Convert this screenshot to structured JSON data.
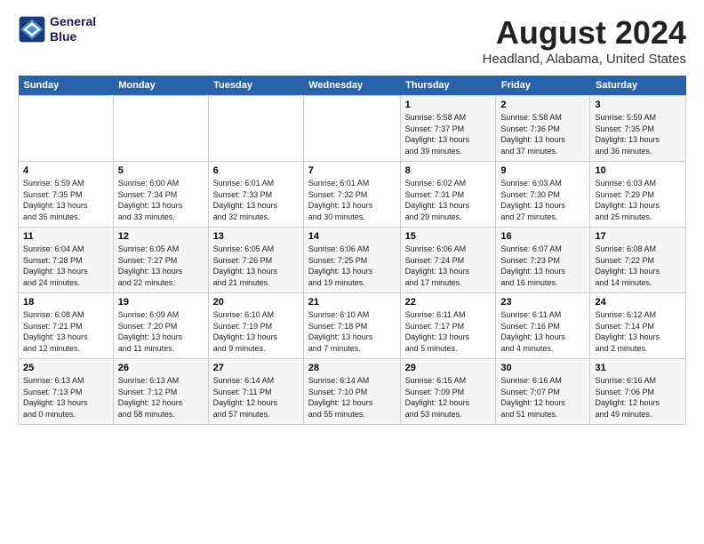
{
  "header": {
    "logo_line1": "General",
    "logo_line2": "Blue",
    "month": "August 2024",
    "location": "Headland, Alabama, United States"
  },
  "weekdays": [
    "Sunday",
    "Monday",
    "Tuesday",
    "Wednesday",
    "Thursday",
    "Friday",
    "Saturday"
  ],
  "weeks": [
    [
      {
        "day": "",
        "info": ""
      },
      {
        "day": "",
        "info": ""
      },
      {
        "day": "",
        "info": ""
      },
      {
        "day": "",
        "info": ""
      },
      {
        "day": "1",
        "info": "Sunrise: 5:58 AM\nSunset: 7:37 PM\nDaylight: 13 hours\nand 39 minutes."
      },
      {
        "day": "2",
        "info": "Sunrise: 5:58 AM\nSunset: 7:36 PM\nDaylight: 13 hours\nand 37 minutes."
      },
      {
        "day": "3",
        "info": "Sunrise: 5:59 AM\nSunset: 7:35 PM\nDaylight: 13 hours\nand 36 minutes."
      }
    ],
    [
      {
        "day": "4",
        "info": "Sunrise: 5:59 AM\nSunset: 7:35 PM\nDaylight: 13 hours\nand 35 minutes."
      },
      {
        "day": "5",
        "info": "Sunrise: 6:00 AM\nSunset: 7:34 PM\nDaylight: 13 hours\nand 33 minutes."
      },
      {
        "day": "6",
        "info": "Sunrise: 6:01 AM\nSunset: 7:33 PM\nDaylight: 13 hours\nand 32 minutes."
      },
      {
        "day": "7",
        "info": "Sunrise: 6:01 AM\nSunset: 7:32 PM\nDaylight: 13 hours\nand 30 minutes."
      },
      {
        "day": "8",
        "info": "Sunrise: 6:02 AM\nSunset: 7:31 PM\nDaylight: 13 hours\nand 29 minutes."
      },
      {
        "day": "9",
        "info": "Sunrise: 6:03 AM\nSunset: 7:30 PM\nDaylight: 13 hours\nand 27 minutes."
      },
      {
        "day": "10",
        "info": "Sunrise: 6:03 AM\nSunset: 7:29 PM\nDaylight: 13 hours\nand 25 minutes."
      }
    ],
    [
      {
        "day": "11",
        "info": "Sunrise: 6:04 AM\nSunset: 7:28 PM\nDaylight: 13 hours\nand 24 minutes."
      },
      {
        "day": "12",
        "info": "Sunrise: 6:05 AM\nSunset: 7:27 PM\nDaylight: 13 hours\nand 22 minutes."
      },
      {
        "day": "13",
        "info": "Sunrise: 6:05 AM\nSunset: 7:26 PM\nDaylight: 13 hours\nand 21 minutes."
      },
      {
        "day": "14",
        "info": "Sunrise: 6:06 AM\nSunset: 7:25 PM\nDaylight: 13 hours\nand 19 minutes."
      },
      {
        "day": "15",
        "info": "Sunrise: 6:06 AM\nSunset: 7:24 PM\nDaylight: 13 hours\nand 17 minutes."
      },
      {
        "day": "16",
        "info": "Sunrise: 6:07 AM\nSunset: 7:23 PM\nDaylight: 13 hours\nand 16 minutes."
      },
      {
        "day": "17",
        "info": "Sunrise: 6:08 AM\nSunset: 7:22 PM\nDaylight: 13 hours\nand 14 minutes."
      }
    ],
    [
      {
        "day": "18",
        "info": "Sunrise: 6:08 AM\nSunset: 7:21 PM\nDaylight: 13 hours\nand 12 minutes."
      },
      {
        "day": "19",
        "info": "Sunrise: 6:09 AM\nSunset: 7:20 PM\nDaylight: 13 hours\nand 11 minutes."
      },
      {
        "day": "20",
        "info": "Sunrise: 6:10 AM\nSunset: 7:19 PM\nDaylight: 13 hours\nand 9 minutes."
      },
      {
        "day": "21",
        "info": "Sunrise: 6:10 AM\nSunset: 7:18 PM\nDaylight: 13 hours\nand 7 minutes."
      },
      {
        "day": "22",
        "info": "Sunrise: 6:11 AM\nSunset: 7:17 PM\nDaylight: 13 hours\nand 5 minutes."
      },
      {
        "day": "23",
        "info": "Sunrise: 6:11 AM\nSunset: 7:16 PM\nDaylight: 13 hours\nand 4 minutes."
      },
      {
        "day": "24",
        "info": "Sunrise: 6:12 AM\nSunset: 7:14 PM\nDaylight: 13 hours\nand 2 minutes."
      }
    ],
    [
      {
        "day": "25",
        "info": "Sunrise: 6:13 AM\nSunset: 7:13 PM\nDaylight: 13 hours\nand 0 minutes."
      },
      {
        "day": "26",
        "info": "Sunrise: 6:13 AM\nSunset: 7:12 PM\nDaylight: 12 hours\nand 58 minutes."
      },
      {
        "day": "27",
        "info": "Sunrise: 6:14 AM\nSunset: 7:11 PM\nDaylight: 12 hours\nand 57 minutes."
      },
      {
        "day": "28",
        "info": "Sunrise: 6:14 AM\nSunset: 7:10 PM\nDaylight: 12 hours\nand 55 minutes."
      },
      {
        "day": "29",
        "info": "Sunrise: 6:15 AM\nSunset: 7:09 PM\nDaylight: 12 hours\nand 53 minutes."
      },
      {
        "day": "30",
        "info": "Sunrise: 6:16 AM\nSunset: 7:07 PM\nDaylight: 12 hours\nand 51 minutes."
      },
      {
        "day": "31",
        "info": "Sunrise: 6:16 AM\nSunset: 7:06 PM\nDaylight: 12 hours\nand 49 minutes."
      }
    ]
  ]
}
